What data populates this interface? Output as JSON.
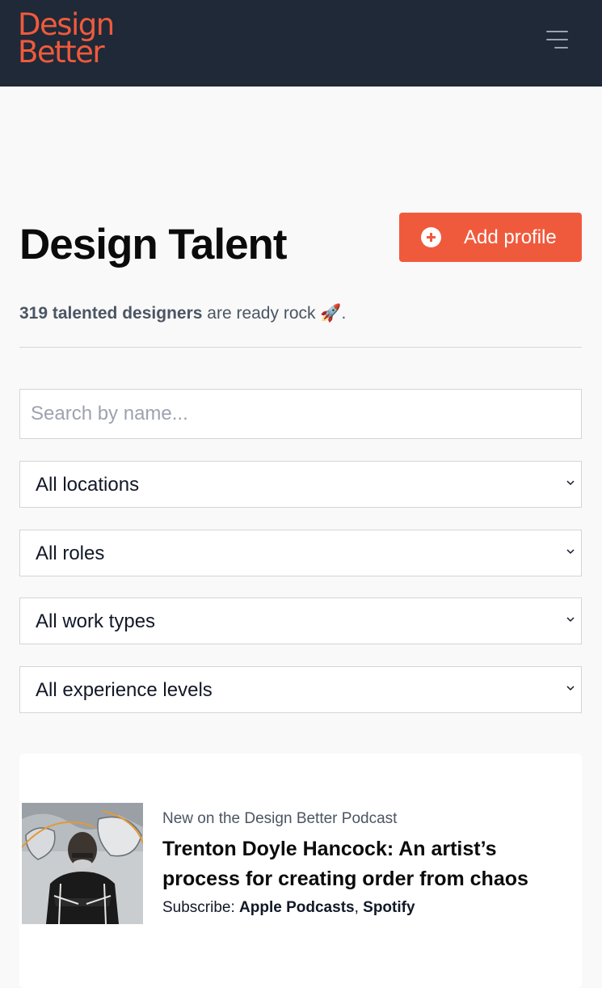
{
  "header": {
    "logo_line1": "Design",
    "logo_line2": "Better",
    "menu_icon": "hamburger-menu-icon",
    "logo_color": "#f05a3c",
    "bg_color": "#1f2937"
  },
  "page": {
    "title": "Design Talent",
    "add_button_label": "Add profile",
    "add_button_icon": "plus-circle-icon",
    "subtitle_count": "319 talented designers",
    "subtitle_rest": " are ready rock ",
    "subtitle_emoji": "🚀",
    "subtitle_end": "."
  },
  "filters": {
    "search_placeholder": "Search by name...",
    "location": "All locations",
    "role": "All roles",
    "work_type": "All work types",
    "experience": "All experience levels"
  },
  "podcast": {
    "eyebrow": "New on the Design Better Podcast",
    "headline": "Trenton Doyle Hancock: An artist’s process for creating order from chaos",
    "subscribe_label": "Subscribe: ",
    "apple_link": "Apple Podcasts",
    "separator": ", ",
    "spotify_link": "Spotify"
  },
  "colors": {
    "accent": "#f05a3c",
    "page_bg": "#f9f9f9"
  }
}
